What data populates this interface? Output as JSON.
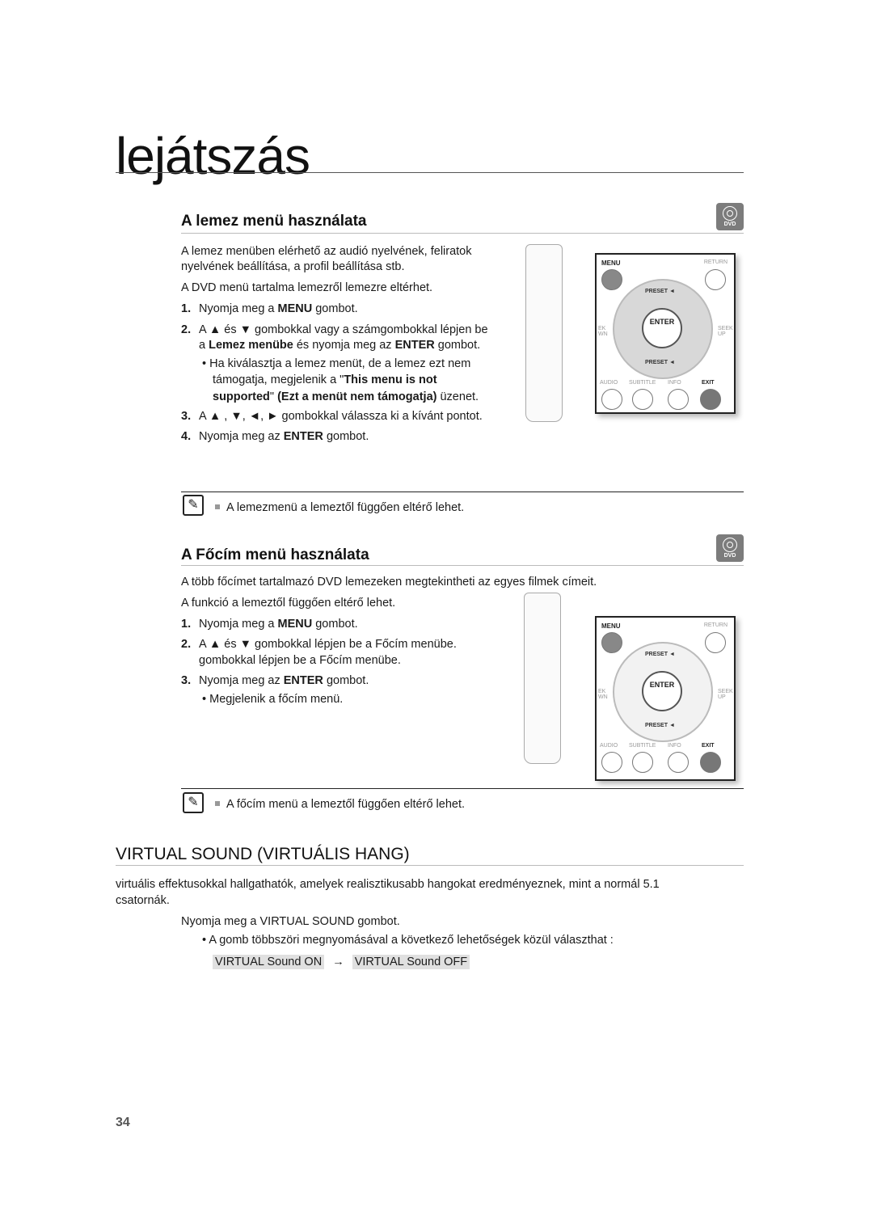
{
  "chapter_title": "lejátszás",
  "section1": {
    "heading": "A lemez menü használata",
    "badge": "DVD",
    "intro1": "A lemez menüben elérhető az audió nyelvének, feliratok",
    "intro2": "nyelvének beállítása, a profil beállítása stb.",
    "intro3": "A DVD menü tartalma lemezről lemezre eltérhet.",
    "step1_num": "1.",
    "step1_a": "Nyomja meg a ",
    "step1_b": "MENU",
    "step1_c": " gombot.",
    "step2_num": "2.",
    "step2_line1": "A ▲ és ▼ gombokkal vagy a számgombokkal lépjen be",
    "step2_l2a": "a ",
    "step2_l2b": "Lemez menübe",
    "step2_l2c": " és nyomja meg az ",
    "step2_l2d": "ENTER",
    "step2_l2e": " gombot.",
    "bullet_l1": "Ha kiválasztja a lemez menüt, de a lemez ezt nem",
    "bullet_l2a": "támogatja, megjelenik a \"",
    "bullet_l2b": "This menu is not",
    "bullet_l3a": "supported",
    "bullet_l3b": "\" ",
    "bullet_l3c": "(Ezt a menüt nem támogatja)",
    "bullet_l3d": " üzenet.",
    "step3_num": "3.",
    "step3": "A ▲ , ▼, ◄, ► gombokkal válassza ki a kívánt pontot.",
    "step4_num": "4.",
    "step4_a": "Nyomja meg az ",
    "step4_b": "ENTER",
    "step4_c": " gombot.",
    "note": "A lemezmenü a lemeztől függően eltérő lehet."
  },
  "section2": {
    "heading": "A Főcím menü használata",
    "badge": "DVD",
    "intro1": "A több főcímet tartalmazó DVD lemezeken megtekintheti az egyes filmek címeit.",
    "intro2": "A funkció a lemeztől függően eltérő lehet.",
    "step1_num": "1.",
    "step1_a": "Nyomja meg a ",
    "step1_b": "MENU",
    "step1_c": " gombot.",
    "step2_num": "2.",
    "step2_line1": "A ▲ és ▼ gombokkal lépjen be a Főcím menübe.",
    "step2_line2": "gombokkal lépjen be a Főcím menübe.",
    "step3_num": "3.",
    "step3_a": "Nyomja meg az ",
    "step3_b": "ENTER",
    "step3_c": " gombot.",
    "bullet": "Megjelenik a főcím menü.",
    "note": "A főcím menü a lemeztől függően eltérő lehet."
  },
  "remote_panel": {
    "menu": "MENU",
    "return": "RETURN",
    "preset_up": "PRESET ◄",
    "preset_down": "PRESET ◄",
    "enter": "ENTER",
    "left_label": "EK WN",
    "right_label": "SEEK UP",
    "audio": "AUDIO",
    "subtitle": "SUBTITLE",
    "info": "INFO",
    "exit": "EXIT"
  },
  "section3": {
    "heading": "VIRTUAL SOUND (VIRTUÁLIS HANG)",
    "intro1": "virtuális effektusokkal hallgathatók, amelyek realisztikusabb hangokat eredményeznek, mint a normál 5.1",
    "intro2": "csatornák.",
    "step": "Nyomja meg a VIRTUAL SOUND gombot.",
    "bullet": "A gomb többszöri megnyomásával a következő lehetőségek közül választhat :",
    "option_on": "VIRTUAL Sound ON",
    "arrow": "→",
    "option_off": "VIRTUAL Sound OFF"
  },
  "page_number": "34"
}
